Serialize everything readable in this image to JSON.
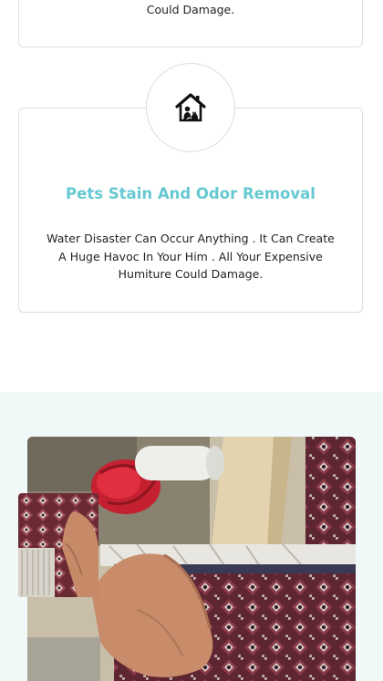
{
  "top_card": {
    "text": "Could Damage."
  },
  "service_card": {
    "icon": "pet-house-icon",
    "title": "Pets Stain And Odor Removal",
    "description": "Water Disaster Can Occur Anything . It Can Create A Huge Havoc In Your Him . All Your Expensive Humiture Could Damage."
  },
  "gallery": {
    "main_image": "carpet-repair-photo",
    "inset_image": "rug-detail-photo"
  },
  "colors": {
    "accent": "#66c9d2",
    "section_background": "#f1f9f8"
  }
}
